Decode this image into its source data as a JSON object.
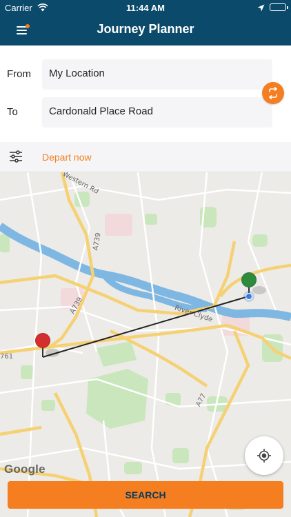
{
  "status_bar": {
    "carrier": "Carrier",
    "time": "11:44 AM",
    "icons": [
      "wifi-icon",
      "location-arrow-icon",
      "battery-icon"
    ]
  },
  "nav": {
    "title": "Journey Planner",
    "menu_icon": "hamburger-menu-icon",
    "notification_dot_color": "#f57e20"
  },
  "form": {
    "from_label": "From",
    "from_value": "My Location",
    "to_label": "To",
    "to_value": "Cardonald Place Road",
    "swap_icon": "swap-direction-icon"
  },
  "options": {
    "filter_icon": "sliders-icon",
    "depart_text": "Depart now"
  },
  "map": {
    "labels": {
      "western_rd": "Western Rd",
      "a739_north": "A739",
      "a739_south": "A739",
      "river_clyde": "River Clyde",
      "a77": "A77",
      "a761": "761"
    },
    "start_marker_color": "#d32f2f",
    "end_marker_color": "#2e8b3e",
    "current_location_color": "#3b7ddd",
    "google_logo": "Google",
    "locate_icon": "crosshair-locate-icon"
  },
  "search_button": "SEARCH",
  "colors": {
    "brand_navy": "#0b4a6b",
    "accent_orange": "#f57e20"
  }
}
